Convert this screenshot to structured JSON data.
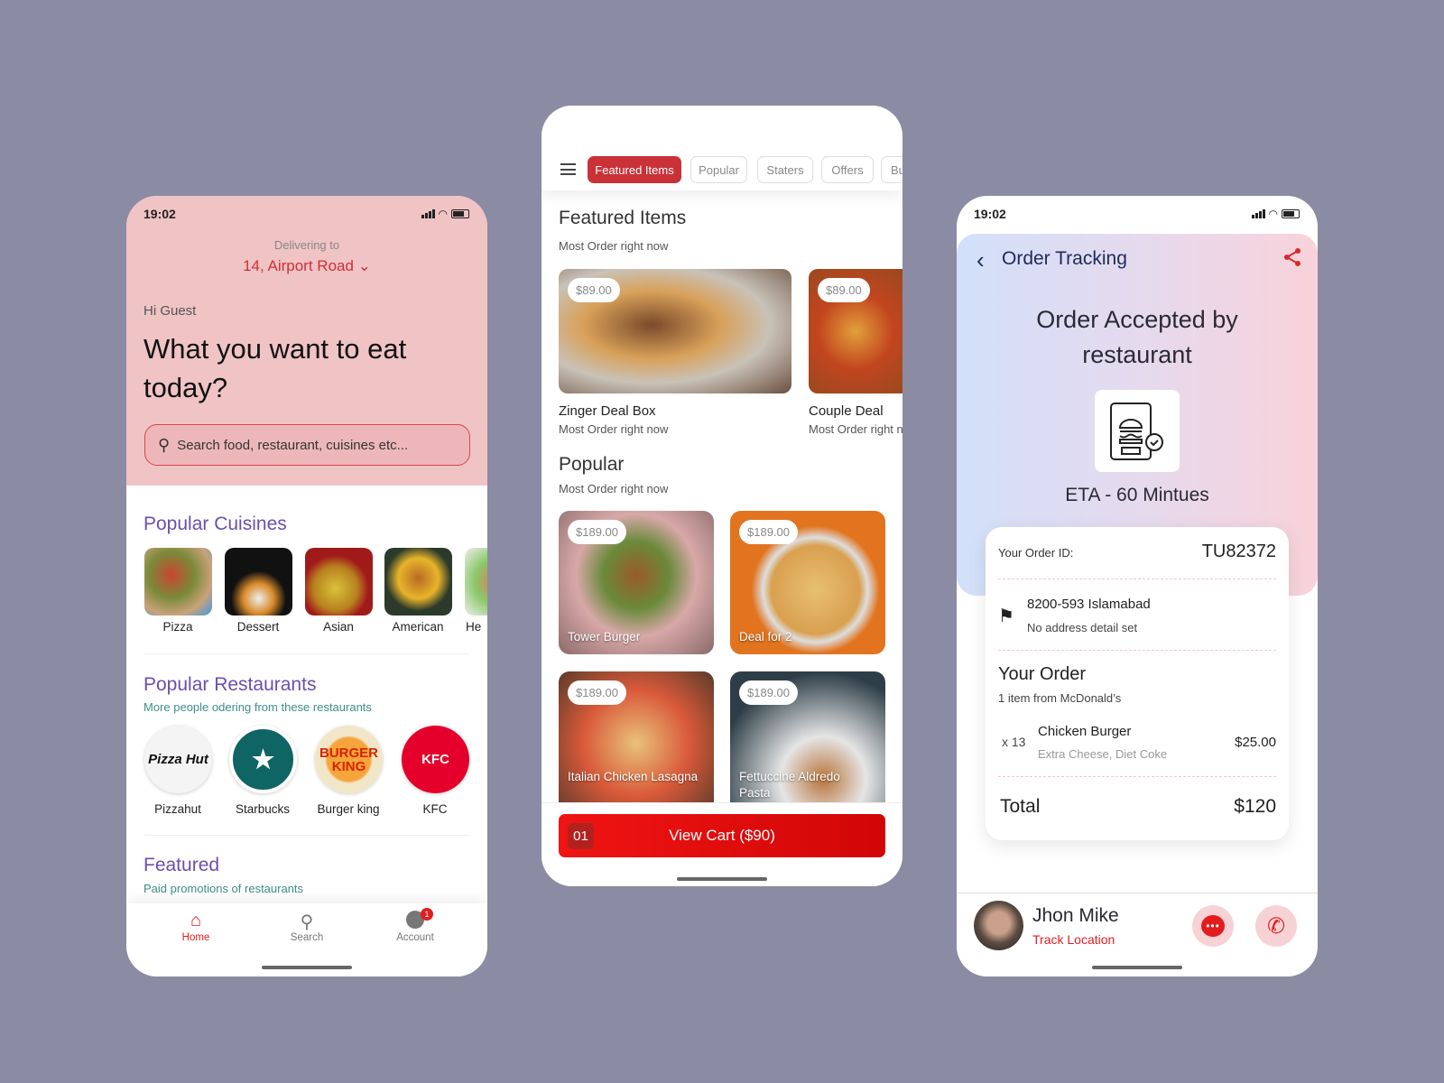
{
  "status": {
    "time": "19:02"
  },
  "home": {
    "delivering_label": "Delivering to",
    "address": "14, Airport Road",
    "greeting": "Hi Guest",
    "headline_1": "What you want to eat",
    "headline_2": "today?",
    "search_placeholder": "Search food, restaurant, cuisines etc...",
    "cuisines_title": "Popular Cuisines",
    "cuisines": [
      {
        "label": "Pizza"
      },
      {
        "label": "Dessert"
      },
      {
        "label": "Asian"
      },
      {
        "label": "American"
      },
      {
        "label": "He"
      }
    ],
    "restaurants_title": "Popular Restaurants",
    "restaurants_subtitle": "More people odering from these restaurants",
    "restaurants": [
      {
        "label": "Pizzahut",
        "logo": "Pizza Hut"
      },
      {
        "label": "Starbucks",
        "logo": "★"
      },
      {
        "label": "Burger king",
        "logo": "BURGER KING"
      },
      {
        "label": "KFC",
        "logo": "KFC"
      }
    ],
    "featured_title": "Featured",
    "featured_subtitle": "Paid promotions of restaurants",
    "nav": [
      {
        "label": "Home",
        "icon": "home-icon",
        "active": true
      },
      {
        "label": "Search",
        "icon": "search-icon"
      },
      {
        "label": "Account",
        "icon": "account-icon",
        "badge": "1"
      }
    ]
  },
  "menu": {
    "tabs": [
      {
        "label": "Featured Items",
        "active": true
      },
      {
        "label": "Popular"
      },
      {
        "label": "Staters"
      },
      {
        "label": "Offers"
      },
      {
        "label": "Bu"
      }
    ],
    "featured_title": "Featured Items",
    "featured_subtitle": "Most Order right now",
    "featured": [
      {
        "name": "Zinger Deal Box",
        "sub": "Most Order right now",
        "price": "$89.00"
      },
      {
        "name": "Couple Deal",
        "sub": "Most Order right now",
        "price": "$89.00"
      }
    ],
    "popular_title": "Popular",
    "popular_subtitle": "Most Order right now",
    "popular": [
      {
        "name": "Tower Burger",
        "price": "$189.00"
      },
      {
        "name": "Deal for 2",
        "price": "$189.00"
      },
      {
        "name": "Italian Chicken Lasagna",
        "price": "$189.00"
      },
      {
        "name": "Fettuccine Aldredo Pasta",
        "price": "$189.00"
      }
    ],
    "cart_count": "01",
    "cart_label": "View Cart ($90)"
  },
  "tracking": {
    "title": "Order Tracking",
    "status_1": "Order Accepted by",
    "status_2": "restaurant",
    "eta": "ETA - 60 Mintues",
    "order_id_label": "Your Order ID:",
    "order_id": "TU82372",
    "address": "8200-593 Islamabad",
    "address_detail": "No address detail set",
    "your_order": "Your Order",
    "item_count": "1 item from McDonald’s",
    "item_qty": "x 13",
    "item_name": "Chicken Burger",
    "item_extras": "Extra Cheese, Diet Coke",
    "item_price": "$25.00",
    "total_label": "Total",
    "total": "$120",
    "driver_name": "Jhon Mike",
    "track_label": "Track Location"
  },
  "colors": {
    "accent": "#e31c1c",
    "purple": "#6a4fb0",
    "teal": "#3f8f86",
    "background": "#8b8ba4"
  }
}
